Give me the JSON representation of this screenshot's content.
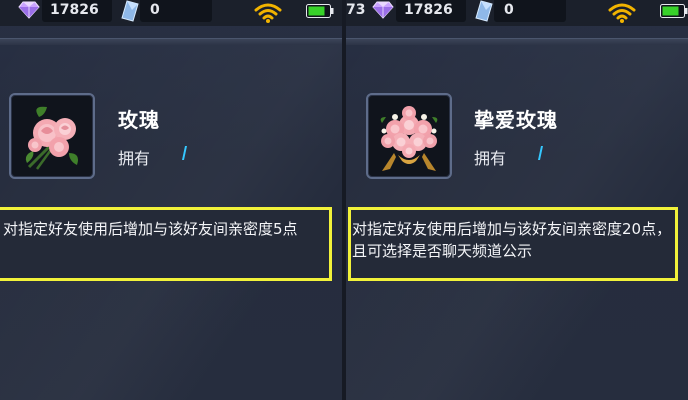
{
  "left_panel": {
    "status_bar": {
      "diamond_count": "17826",
      "crystal_count": "0",
      "wifi_icon": "wifi-icon",
      "battery_icon": "battery-icon",
      "battery_level": 0.8,
      "accent_color": "#f2b400"
    },
    "item": {
      "name": "玫瑰",
      "owned_label": "拥有",
      "icon": "rose-bouquet-icon",
      "description": "对指定好友使用后增加与该好友间亲密度5点"
    }
  },
  "right_panel": {
    "status_bar": {
      "cut_off_text": "73",
      "diamond_count": "17826",
      "crystal_count": "0",
      "wifi_icon": "wifi-icon",
      "battery_icon": "battery-icon",
      "battery_level": 0.8,
      "accent_color": "#f2b400"
    },
    "item": {
      "name": "挚爱玫瑰",
      "owned_label": "拥有",
      "icon": "large-rose-bouquet-icon",
      "description": "对指定好友使用后增加与该好友间亲密度20点，且可选择是否聊天频道公示"
    }
  },
  "colors": {
    "highlight_border": "#f2f23a",
    "owned_mark": "#35c8ff",
    "battery_green": "#38d22a"
  }
}
